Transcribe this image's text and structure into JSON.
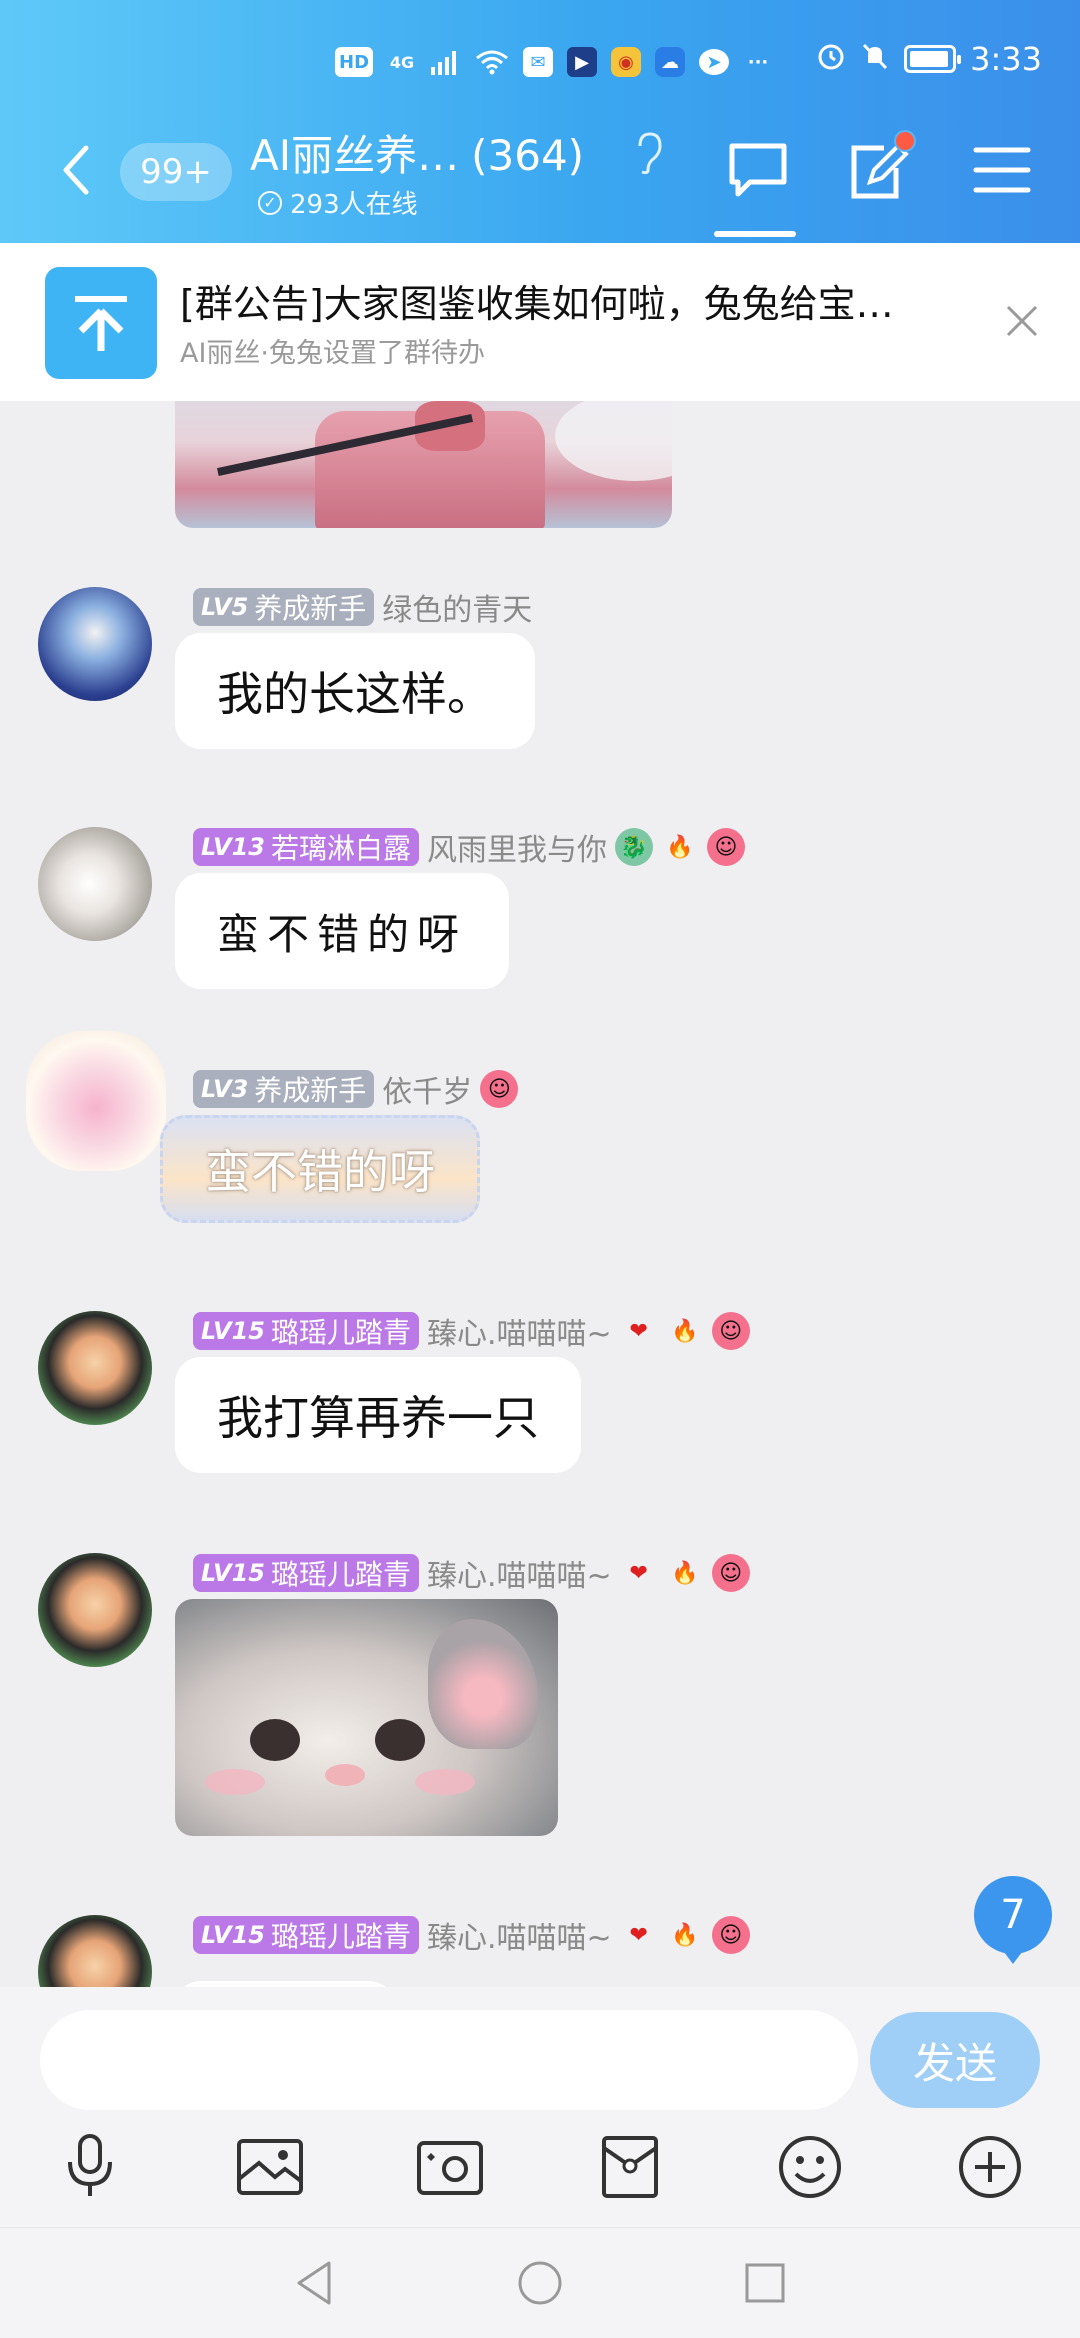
{
  "status_bar": {
    "icons": [
      "HD",
      "4G",
      "signal",
      "wifi",
      "mail",
      "qq",
      "weibo",
      "weather",
      "app",
      "more"
    ],
    "more": "···",
    "time": "3:33"
  },
  "header": {
    "unread": "99+",
    "title": "AI丽丝养…",
    "member_count": "(364)",
    "online": "293人在线"
  },
  "announcement": {
    "title": "[群公告]大家图鉴收集如何啦，兔兔给宝…",
    "subtitle": "AI丽丝·兔兔设置了群待办"
  },
  "messages": [
    {
      "level": "LV5",
      "title": "养成新手",
      "nick": "绿色的青天",
      "text": "我的长这样。"
    },
    {
      "level": "LV13",
      "title": "若璃淋白露",
      "nick": "风雨里我与你",
      "text": "蛮不错的呀"
    },
    {
      "level": "LV3",
      "title": "养成新手",
      "nick": "依千岁",
      "text": "蛮不错的呀"
    },
    {
      "level": "LV15",
      "title": "璐瑶儿踏青",
      "nick": "臻心.喵喵喵~",
      "text": "我打算再养一只"
    },
    {
      "level": "LV15",
      "title": "璐瑶儿踏青",
      "nick": "臻心.喵喵喵~",
      "text": ""
    },
    {
      "level": "LV15",
      "title": "璐瑶儿踏青",
      "nick": "臻心.喵喵喵~",
      "text": ""
    }
  ],
  "unread_float": "7",
  "input": {
    "placeholder": "",
    "send_label": "发送"
  },
  "toolbar": [
    "mic-icon",
    "image-icon",
    "camera-icon",
    "redpacket-icon",
    "emoji-icon",
    "plus-icon"
  ],
  "colors": {
    "header_start": "#5ec9f8",
    "header_end": "#3b8fea",
    "level_gray": "#a9afbd",
    "level_purple": "#bb79e8",
    "send": "#9fcff6"
  }
}
